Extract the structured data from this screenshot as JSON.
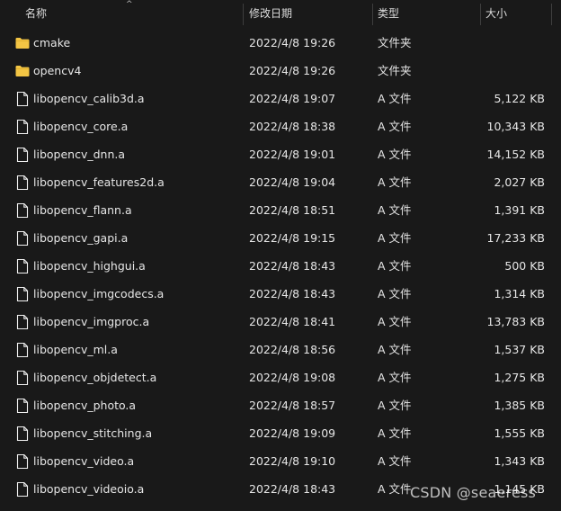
{
  "header": {
    "name": "名称",
    "date": "修改日期",
    "type": "类型",
    "size": "大小",
    "sort_indicator": "^"
  },
  "files": [
    {
      "kind": "folder",
      "icon": "folder-icon",
      "name": "cmake",
      "date": "2022/4/8 19:26",
      "type": "文件夹",
      "size": ""
    },
    {
      "kind": "folder",
      "icon": "folder-icon",
      "name": "opencv4",
      "date": "2022/4/8 19:26",
      "type": "文件夹",
      "size": ""
    },
    {
      "kind": "file",
      "icon": "file-icon",
      "name": "libopencv_calib3d.a",
      "date": "2022/4/8 19:07",
      "type": "A 文件",
      "size": "5,122 KB"
    },
    {
      "kind": "file",
      "icon": "file-icon",
      "name": "libopencv_core.a",
      "date": "2022/4/8 18:38",
      "type": "A 文件",
      "size": "10,343 KB"
    },
    {
      "kind": "file",
      "icon": "file-icon",
      "name": "libopencv_dnn.a",
      "date": "2022/4/8 19:01",
      "type": "A 文件",
      "size": "14,152 KB"
    },
    {
      "kind": "file",
      "icon": "file-icon",
      "name": "libopencv_features2d.a",
      "date": "2022/4/8 19:04",
      "type": "A 文件",
      "size": "2,027 KB"
    },
    {
      "kind": "file",
      "icon": "file-icon",
      "name": "libopencv_flann.a",
      "date": "2022/4/8 18:51",
      "type": "A 文件",
      "size": "1,391 KB"
    },
    {
      "kind": "file",
      "icon": "file-icon",
      "name": "libopencv_gapi.a",
      "date": "2022/4/8 19:15",
      "type": "A 文件",
      "size": "17,233 KB"
    },
    {
      "kind": "file",
      "icon": "file-icon",
      "name": "libopencv_highgui.a",
      "date": "2022/4/8 18:43",
      "type": "A 文件",
      "size": "500 KB"
    },
    {
      "kind": "file",
      "icon": "file-icon",
      "name": "libopencv_imgcodecs.a",
      "date": "2022/4/8 18:43",
      "type": "A 文件",
      "size": "1,314 KB"
    },
    {
      "kind": "file",
      "icon": "file-icon",
      "name": "libopencv_imgproc.a",
      "date": "2022/4/8 18:41",
      "type": "A 文件",
      "size": "13,783 KB"
    },
    {
      "kind": "file",
      "icon": "file-icon",
      "name": "libopencv_ml.a",
      "date": "2022/4/8 18:56",
      "type": "A 文件",
      "size": "1,537 KB"
    },
    {
      "kind": "file",
      "icon": "file-icon",
      "name": "libopencv_objdetect.a",
      "date": "2022/4/8 19:08",
      "type": "A 文件",
      "size": "1,275 KB"
    },
    {
      "kind": "file",
      "icon": "file-icon",
      "name": "libopencv_photo.a",
      "date": "2022/4/8 18:57",
      "type": "A 文件",
      "size": "1,385 KB"
    },
    {
      "kind": "file",
      "icon": "file-icon",
      "name": "libopencv_stitching.a",
      "date": "2022/4/8 19:09",
      "type": "A 文件",
      "size": "1,555 KB"
    },
    {
      "kind": "file",
      "icon": "file-icon",
      "name": "libopencv_video.a",
      "date": "2022/4/8 19:10",
      "type": "A 文件",
      "size": "1,343 KB"
    },
    {
      "kind": "file",
      "icon": "file-icon",
      "name": "libopencv_videoio.a",
      "date": "2022/4/8 18:43",
      "type": "A 文件",
      "size": "1,145 KB"
    }
  ],
  "watermark": "CSDN @seaeress",
  "colors": {
    "background": "#191919",
    "text": "#e6e6e6",
    "folder": "#f3c544",
    "file": "#f2f2f2"
  }
}
